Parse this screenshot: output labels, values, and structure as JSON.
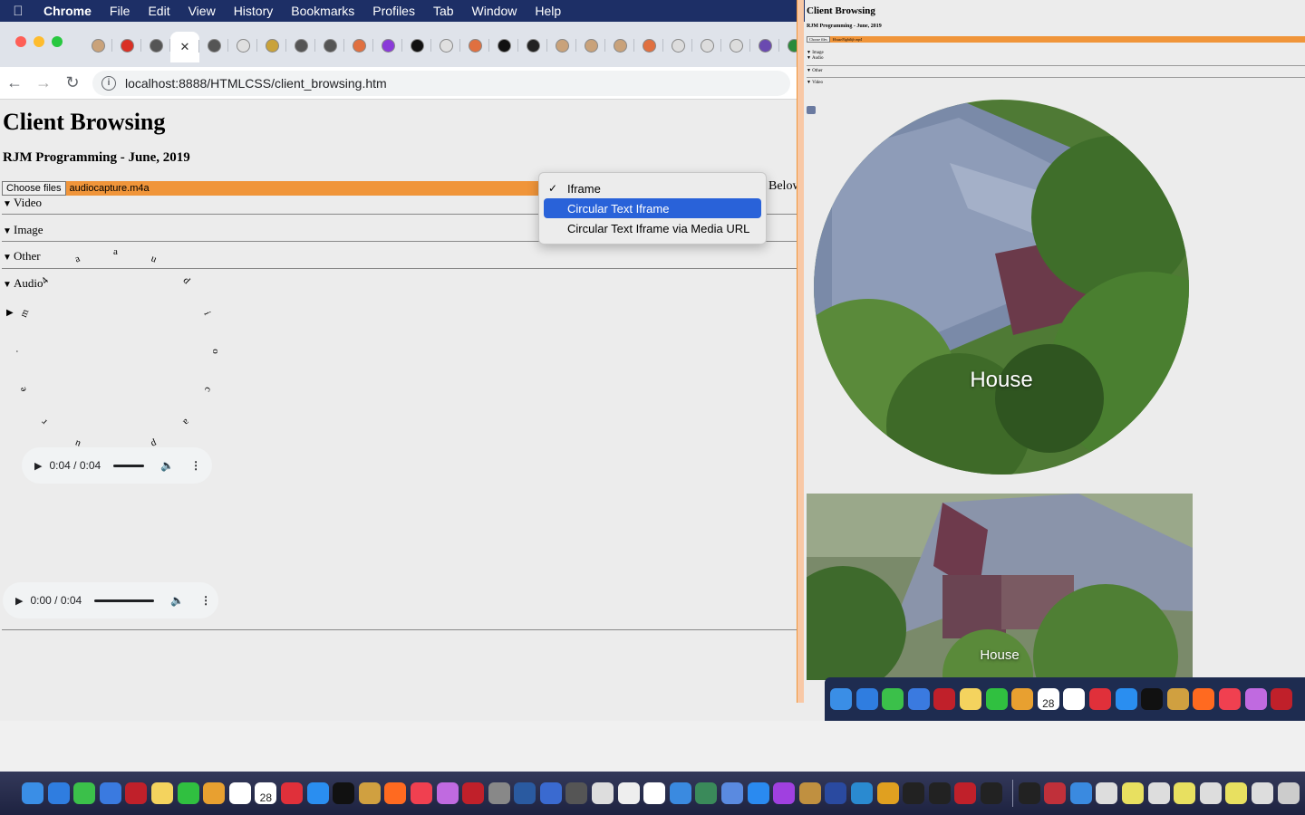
{
  "menubar": {
    "app": "Chrome",
    "items": [
      "File",
      "Edit",
      "View",
      "History",
      "Bookmarks",
      "Profiles",
      "Tab",
      "Window",
      "Help"
    ]
  },
  "browser": {
    "active_tab_close": "✕",
    "url": "localhost:8888/HTMLCSS/client_browsing.htm",
    "tab_colors": [
      "#c9a27a",
      "#d93025",
      "#555",
      "#fff",
      "#555",
      "#e0e0e0",
      "#c9a23a",
      "#555",
      "#555",
      "#e07040",
      "#8a3ad9",
      "#111",
      "#e0e0e0",
      "#e07040",
      "#111",
      "#222",
      "#c9a27a",
      "#c9a27a",
      "#c9a27a",
      "#e07040",
      "#ddd",
      "#ddd",
      "#ddd",
      "#6a4ab0",
      "#2a8a3a"
    ]
  },
  "page": {
    "title": "Client Browsing",
    "subtitle": "RJM Programming - June, 2019",
    "choose_files": "Choose files",
    "file_name": "audiocapture.m4a",
    "below_label": "Below",
    "sections": [
      "Video",
      "Image",
      "Other",
      "Audio"
    ],
    "circular_letters": [
      "a",
      "u",
      "d",
      "i",
      "o",
      "c",
      "a",
      "p",
      "t",
      "u",
      "r",
      "e",
      ".",
      "m",
      "4",
      "a"
    ],
    "audio1": {
      "time": "0:04 / 0:04"
    },
    "audio2": {
      "time": "0:00 / 0:04"
    }
  },
  "dropdown": {
    "options": [
      "Iframe",
      "Circular Text Iframe",
      "Circular Text Iframe via Media URL"
    ],
    "checked_index": 0,
    "highlighted_index": 1
  },
  "right": {
    "title": "Client Browsing",
    "subtitle": "RJM Programming - June, 2019",
    "choose_files": "Choose files",
    "file_name": "HouseNightlife.mp4",
    "sections": [
      "Image",
      "Audio",
      "Other",
      "Video"
    ],
    "label1": "House",
    "label2": "House"
  },
  "dock": {
    "calendar_day": "28"
  }
}
